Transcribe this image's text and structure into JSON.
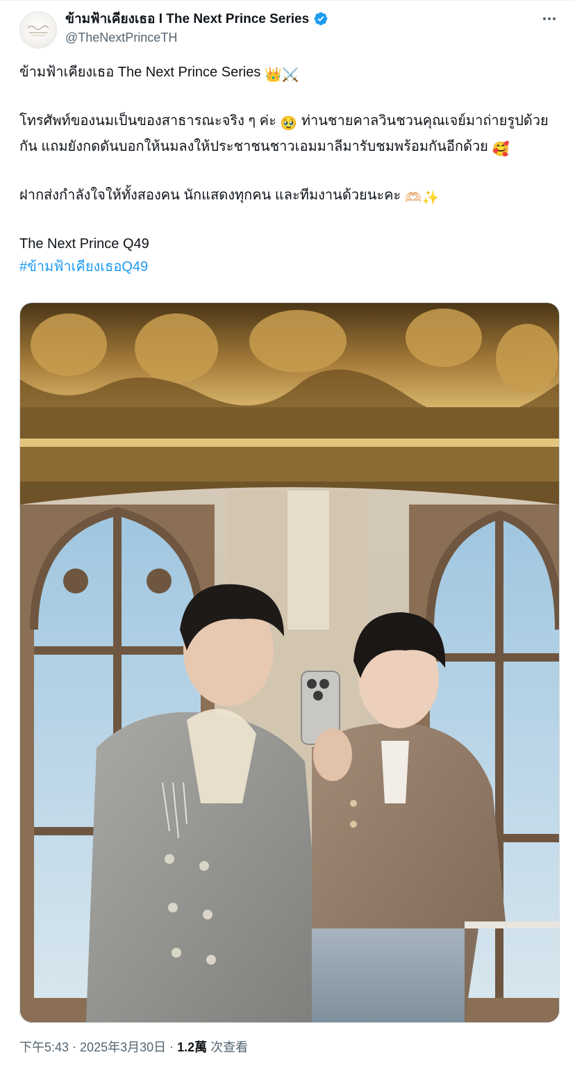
{
  "author": {
    "display_name": "ข้ามฟ้าเคียงเธอ I The Next Prince Series",
    "handle": "@TheNextPrinceTH",
    "verified": true,
    "avatar_icon": "the-next-prince-logo",
    "accent": "#1d9bf0"
  },
  "menu": {
    "icon": "more-horizontal-icon"
  },
  "tweet": {
    "line1_text": "ข้ามฟ้าเคียงเธอ The Next Prince Series ",
    "line1_emoji_1": "👑",
    "line1_emoji_2": "⚔️",
    "para2_text_a": "โทรศัพท์ของนมเป็นของสาธารณะจริง ๆ ค่ะ ",
    "para2_emoji_1": "🥹",
    "para2_text_b": " ท่านชายคาลวินชวนคุณเจย์มาถ่ายรูปด้วยกัน แถมยังกดดันบอกให้นมลงให้ประชาชนชาวเอมมาลีมารับชมพร้อมกันอีกด้วย ",
    "para2_emoji_2": "🥰",
    "para3_text": "ฝากส่งกำลังใจให้ทั้งสองคน นักแสดงทุกคน และทีมงานด้วยนะคะ ",
    "para3_emoji_1": "🫶🏻",
    "para3_emoji_2": "✨",
    "para4_text": "The Next Prince Q49",
    "hashtag": "#ข้ามฟ้าเคียงเธอQ49",
    "hashtag_color": "#1d9bf0"
  },
  "media": {
    "description_icon": "photo"
  },
  "footer": {
    "time": "下午5:43",
    "separator_1": "·",
    "date": "2025年3月30日",
    "separator_2": "·",
    "views": "1.2萬",
    "views_label": "次查看"
  }
}
